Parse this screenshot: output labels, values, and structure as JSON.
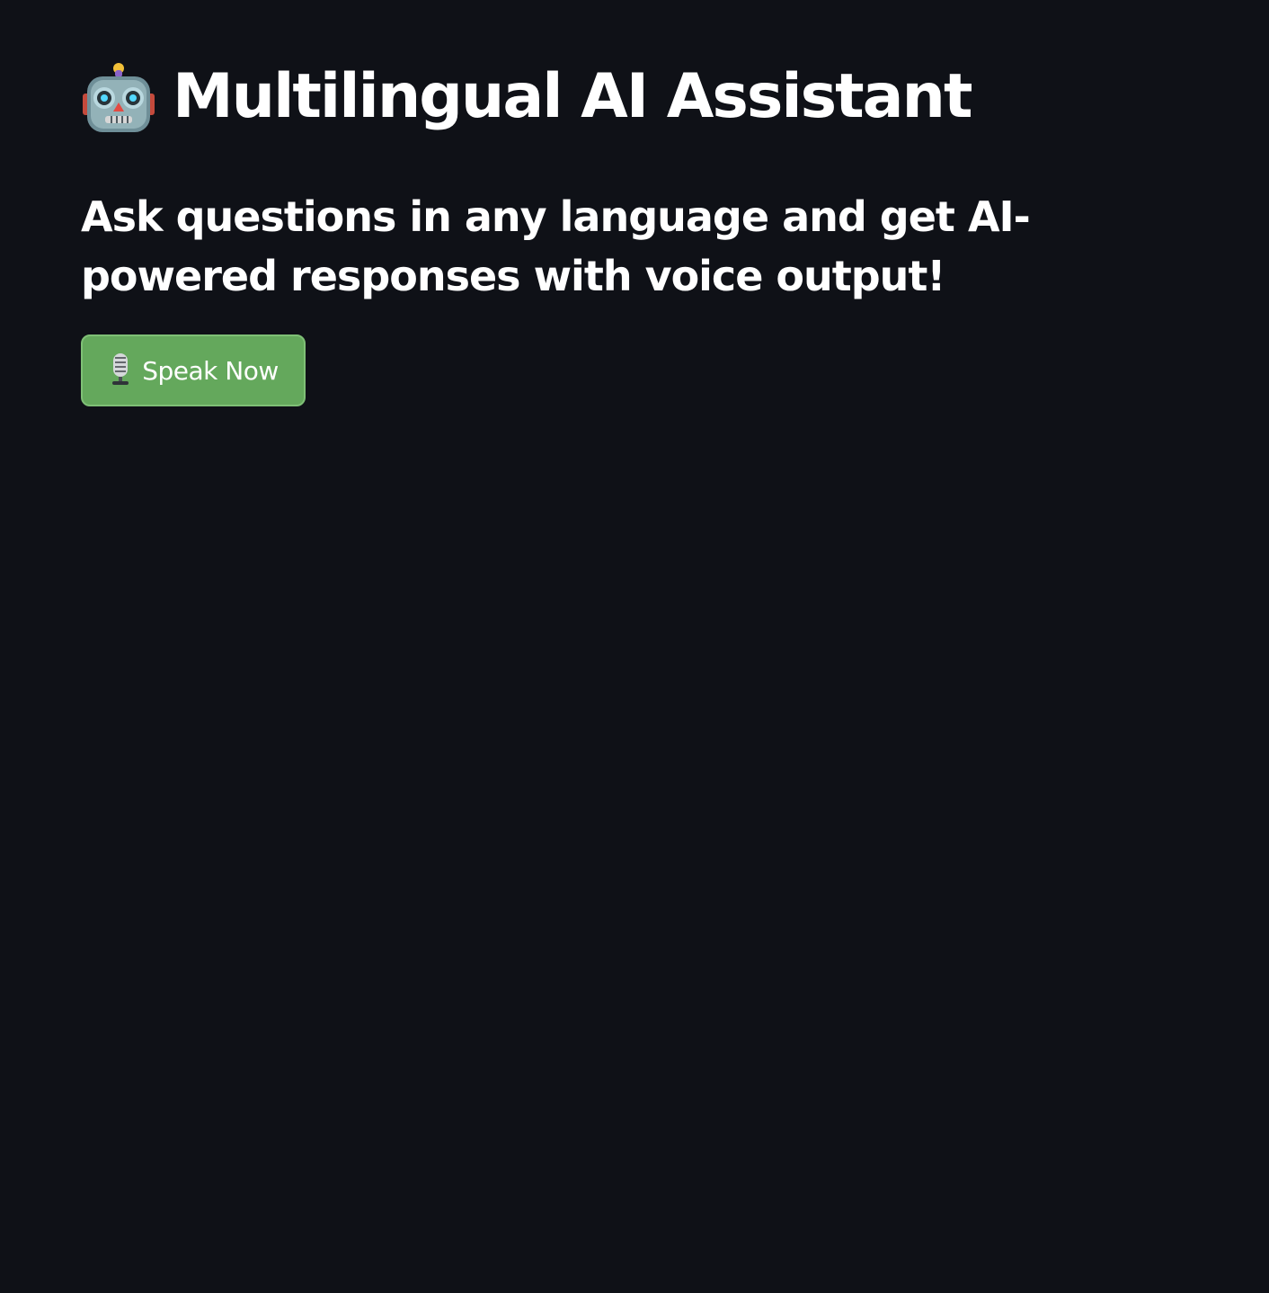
{
  "header": {
    "title": "Multilingual AI Assistant",
    "title_icon": "robot-icon",
    "subtitle": "Ask questions in any language and get AI-powered responses with voice output!"
  },
  "actions": {
    "speak_button": {
      "label": "Speak Now",
      "icon": "microphone-icon"
    }
  },
  "theme": {
    "background": "#0f1117",
    "text": "#ffffff",
    "button_green": "#64a85c"
  }
}
